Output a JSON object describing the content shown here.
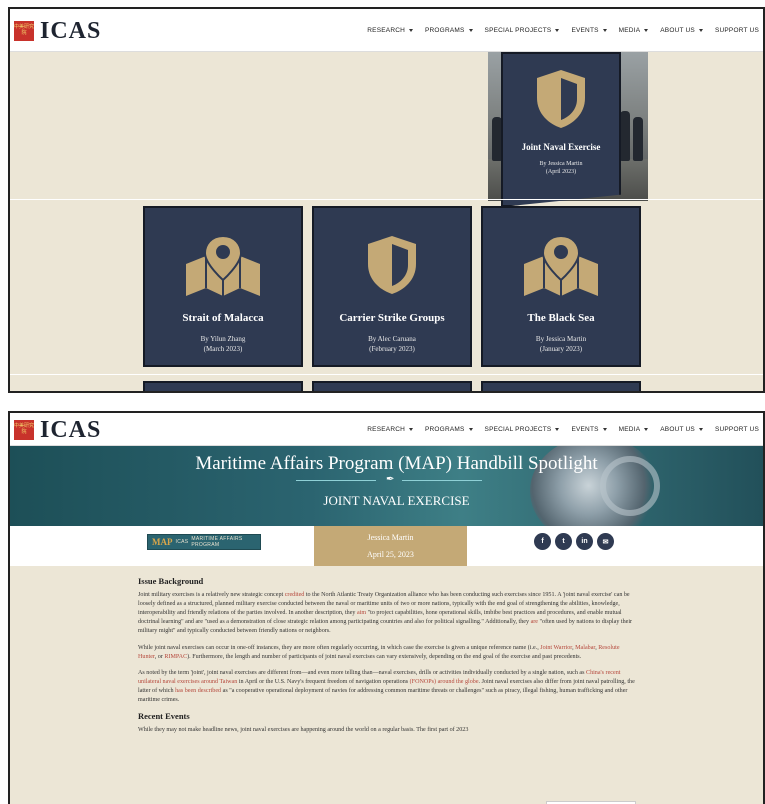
{
  "nav": {
    "logo_text": "ICAS",
    "logo_mark": "中美研究院",
    "items": [
      {
        "label": "RESEARCH",
        "dropdown": true
      },
      {
        "label": "PROGRAMS",
        "dropdown": true
      },
      {
        "label": "SPECIAL PROJECTS",
        "dropdown": true
      },
      {
        "label": "EVENTS",
        "dropdown": true
      },
      {
        "label": "MEDIA",
        "dropdown": true
      },
      {
        "label": "ABOUT US",
        "dropdown": true
      },
      {
        "label": "SUPPORT US",
        "dropdown": false
      }
    ]
  },
  "colors": {
    "card_bg": "#2f3a52",
    "icon_gold": "#c4a976",
    "banner": "#2b6470",
    "link": "#b5473b"
  },
  "top_frame": {
    "featured_card": {
      "icon": "shield-icon",
      "title": "Joint Naval Exercise",
      "author": "By Jessica Martin",
      "date": "(April 2023)"
    },
    "cards": [
      {
        "icon": "map-pin-icon",
        "title": "Strait of Malacca",
        "author": "By Yilun Zhang",
        "date": "(March 2023)"
      },
      {
        "icon": "shield-icon",
        "title": "Carrier Strike Groups",
        "author": "By Alec Caruana",
        "date": "(February 2023)"
      },
      {
        "icon": "map-pin-icon",
        "title": "The Black Sea",
        "author": "By Jessica Martin",
        "date": "(January 2023)"
      }
    ]
  },
  "article_page": {
    "banner_title": "Maritime Affairs Program (MAP) Handbill Spotlight",
    "banner_subtitle": "JOINT NAVAL EXERCISE",
    "program_badge": {
      "abbr": "MAP",
      "org": "ICAS",
      "name": "MARITIME AFFAIRS PROGRAM"
    },
    "author": "Jessica Martin",
    "date": "April 25, 2023",
    "social_icons": [
      "facebook-icon",
      "twitter-icon",
      "linkedin-icon",
      "email-icon"
    ],
    "section1_heading": "Issue Background",
    "p1": [
      {
        "t": "Joint military exercises is a relatively new strategic concept "
      },
      {
        "t": "credited",
        "link": true
      },
      {
        "t": " to the North Atlantic Treaty Organization alliance who has been conducting such exercises since 1951. A 'joint naval exercise' can be loosely defined as a structured, planned military exercise conducted between the naval or maritime units of two or more nations, typically with the end goal of strengthening the abilities, knowledge, interoperability and friendly relations of the parties involved. In another description, they "
      },
      {
        "t": "aim",
        "link": true
      },
      {
        "t": " \"to project capabilities, hone operational skills, imbibe best practices and procedures, and enable mutual doctrinal learning\" and are \"used as a demonstration of close strategic relation among participating countries and also for political signalling.\" Additionally, they "
      },
      {
        "t": "are",
        "link": true
      },
      {
        "t": " \"often used by nations to display their military might\" and typically conducted between friendly nations or neighbors."
      }
    ],
    "p2": [
      {
        "t": "While joint naval exercises can occur in one-off instances, they are more often regularly occurring, in which case the exercise is given a unique reference name (i.e., "
      },
      {
        "t": "Joint Warrior",
        "link": true
      },
      {
        "t": ", "
      },
      {
        "t": "Malabar",
        "link": true
      },
      {
        "t": ", "
      },
      {
        "t": "Resolute Hunter",
        "link": true
      },
      {
        "t": ", or "
      },
      {
        "t": "RIMPAC",
        "link": true
      },
      {
        "t": "). Furthermore, the length and number of participants of joint naval exercises can vary extensively, depending on the end goal of the exercise and past precedents."
      }
    ],
    "p3": [
      {
        "t": "As noted by the term 'joint', joint naval exercises are different from—and even more telling than—naval exercises, drills or activities individually conducted by a single nation, such as "
      },
      {
        "t": "China's recent unilateral naval exercises around Taiwan",
        "link": true
      },
      {
        "t": " in April or the U.S. Navy's frequent freedom of navigation operations "
      },
      {
        "t": "(FONOPs) around the globe",
        "link": true
      },
      {
        "t": ". Joint naval exercises also differ from joint naval patrolling, the latter of which "
      },
      {
        "t": "has been described",
        "link": true
      },
      {
        "t": " as \"a cooperative operational deployment of navies for addressing common maritime threats or challenges\" such as piracy, illegal fishing, human trafficking and other maritime crimes."
      }
    ],
    "section2_heading": "Recent Events",
    "p4": [
      {
        "t": "While they may not make headline news, joint naval exercises are happening around the world on a regular basis. The first part of 2023 "
      }
    ]
  }
}
